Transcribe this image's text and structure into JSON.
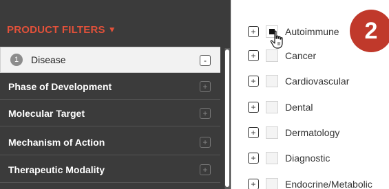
{
  "filters": {
    "header": "PRODUCT FILTERS",
    "caret_icon": "caret-down-icon",
    "active_item": {
      "step": "1",
      "label": "Disease",
      "button_symbol": "-"
    },
    "items": [
      {
        "label": "Phase of Development",
        "button_symbol": "+"
      },
      {
        "label": "Molecular Target",
        "button_symbol": "+"
      },
      {
        "label": "Mechanism of Action",
        "button_symbol": "+"
      },
      {
        "label": "Therapeutic Modality",
        "button_symbol": "+"
      }
    ]
  },
  "options": [
    {
      "label": "Autoimmune",
      "expand_symbol": "+",
      "checked": true
    },
    {
      "label": "Cancer",
      "expand_symbol": "+",
      "checked": false
    },
    {
      "label": "Cardiovascular",
      "expand_symbol": "+",
      "checked": false
    },
    {
      "label": "Dental",
      "expand_symbol": "+",
      "checked": false
    },
    {
      "label": "Dermatology",
      "expand_symbol": "+",
      "checked": false
    },
    {
      "label": "Diagnostic",
      "expand_symbol": "+",
      "checked": false
    },
    {
      "label": "Endocrine/Metabolic",
      "expand_symbol": "+",
      "checked": false
    }
  ],
  "step_callout": "2",
  "colors": {
    "accent": "#e2513a",
    "panel": "#3b3b3b",
    "callout": "#c0392b"
  }
}
